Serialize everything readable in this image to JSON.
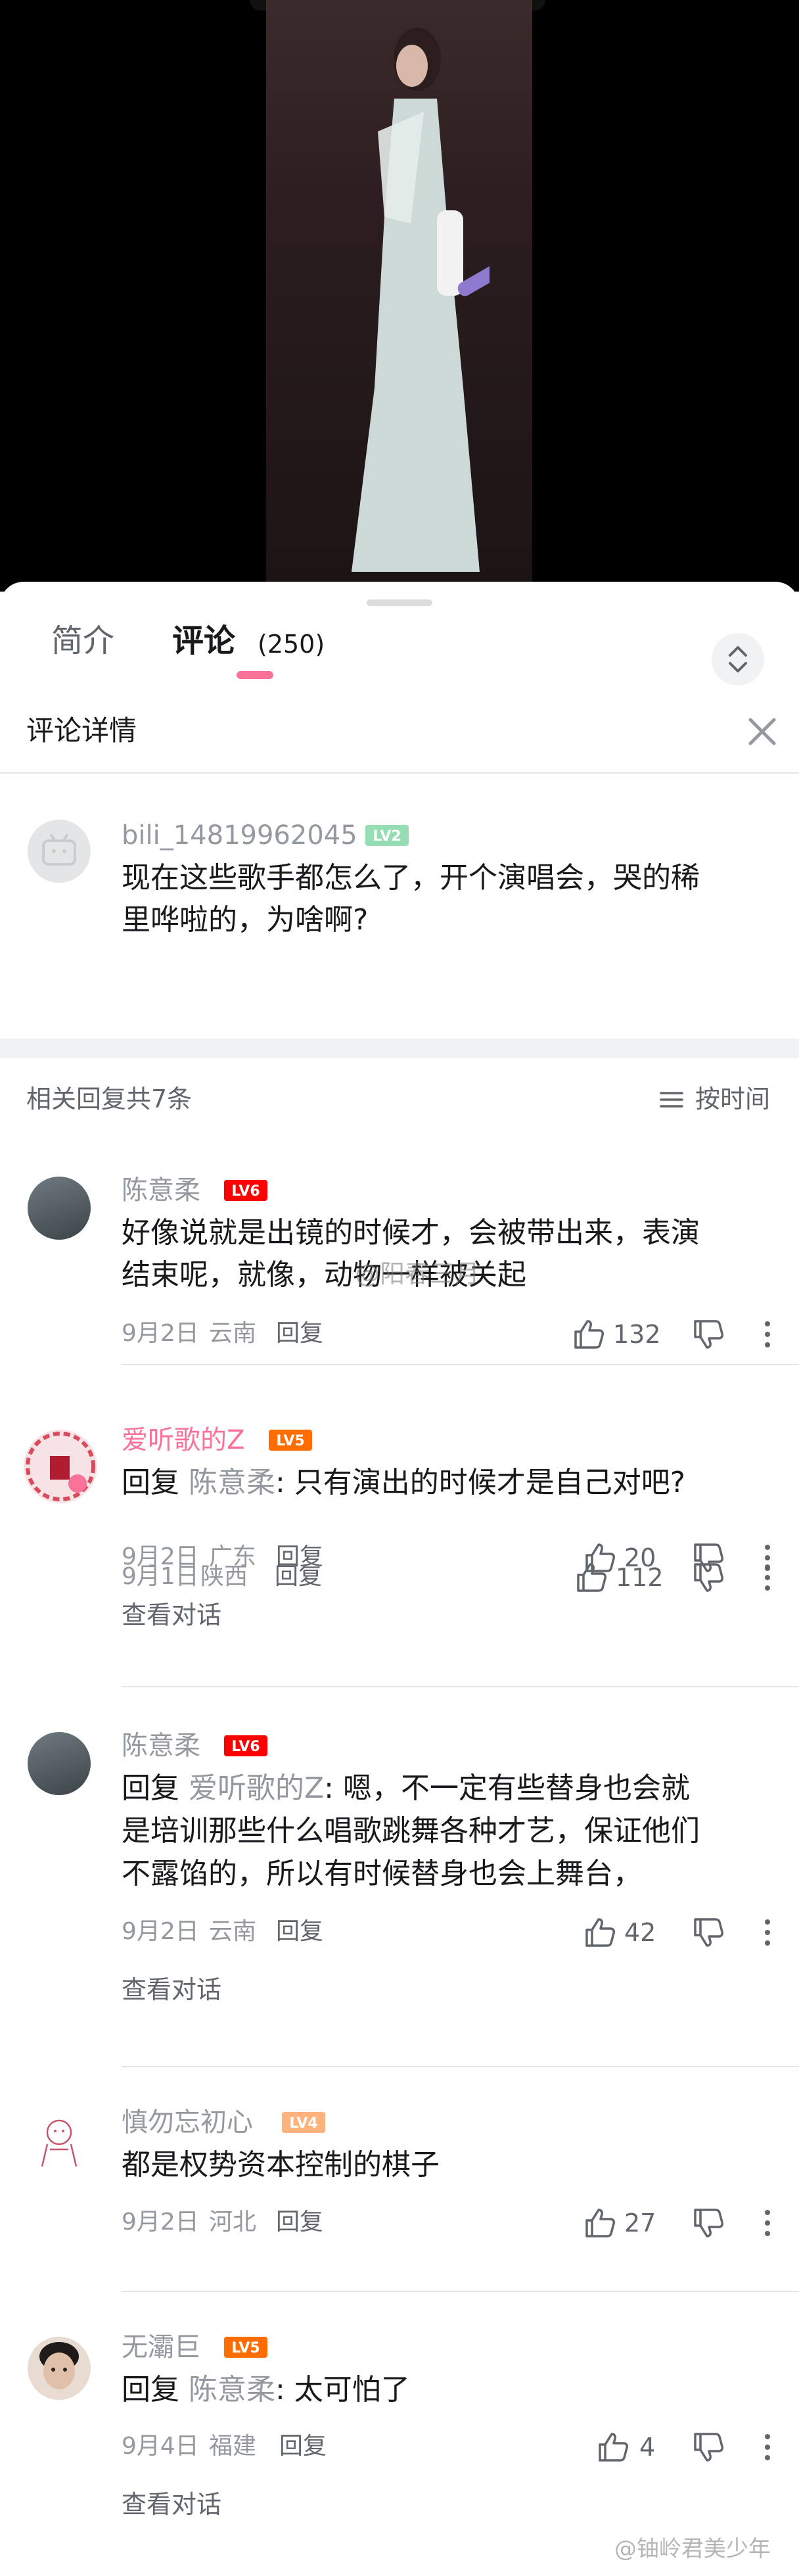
{
  "tabs": {
    "intro": "简介",
    "comments": "评论",
    "count": "(250)"
  },
  "detail": {
    "title": "评论详情"
  },
  "root_comment": {
    "user": "bili_14819962045",
    "level": "LV2",
    "line1": "现在这些歌手都怎么了，开个演唱会，哭的稀",
    "line2": "里哗啦的，为啥啊?",
    "date": "9月1日",
    "location": "陕西",
    "reply_label": "回复",
    "likes": "112"
  },
  "related": {
    "count_text": "相关回复共7条",
    "sort_label": "按时间"
  },
  "replies": [
    {
      "user": "陈意柔",
      "level": "LV6",
      "line1": "好像说就是出镜的时候才，会被带出来，表演",
      "line2": "结束呢，就像，动物一样被关起",
      "date": "9月2日",
      "location": "云南",
      "reply_label": "回复",
      "likes": "132"
    },
    {
      "user": "爱听歌的Z",
      "level": "LV5",
      "prefix": "回复",
      "target": "陈意柔",
      "line1": ": 只有演出的时候才是自己对吧?",
      "date": "9月2日",
      "location": "广东",
      "reply_label": "回复",
      "likes": "20",
      "view": "查看对话"
    },
    {
      "user": "陈意柔",
      "level": "LV6",
      "prefix": "回复",
      "target": "爱听歌的Z",
      "line1": ": 嗯，不一定有些替身也会就",
      "line2": "是培训那些什么唱歌跳舞各种才艺，保证他们",
      "line3": "不露馅的，所以有时候替身也会上舞台，",
      "date": "9月2日",
      "location": "云南",
      "reply_label": "回复",
      "likes": "42",
      "view": "查看对话"
    },
    {
      "user": "慎勿忘初心",
      "level": "LV4",
      "line1": "都是权势资本控制的棋子",
      "date": "9月2日",
      "location": "河北",
      "reply_label": "回复",
      "likes": "27"
    },
    {
      "user": "无灞巨",
      "level": "LV5",
      "prefix": "回复",
      "target": "陈意柔",
      "line1": ": 太可怕了",
      "date": "9月4日",
      "location": "福建",
      "reply_label": "回复",
      "likes": "4",
      "view": "查看对话"
    }
  ],
  "watermarks": {
    "mid": "@阳春三月",
    "bottom": "@铀岭君美少年"
  },
  "colors": {
    "accent": "#fb7299",
    "lv2": "#95ddb2",
    "lv4": "#ffb37c",
    "lv5": "#ff6c00",
    "lv6": "#ff0000",
    "vip_name": "#fb7299"
  }
}
